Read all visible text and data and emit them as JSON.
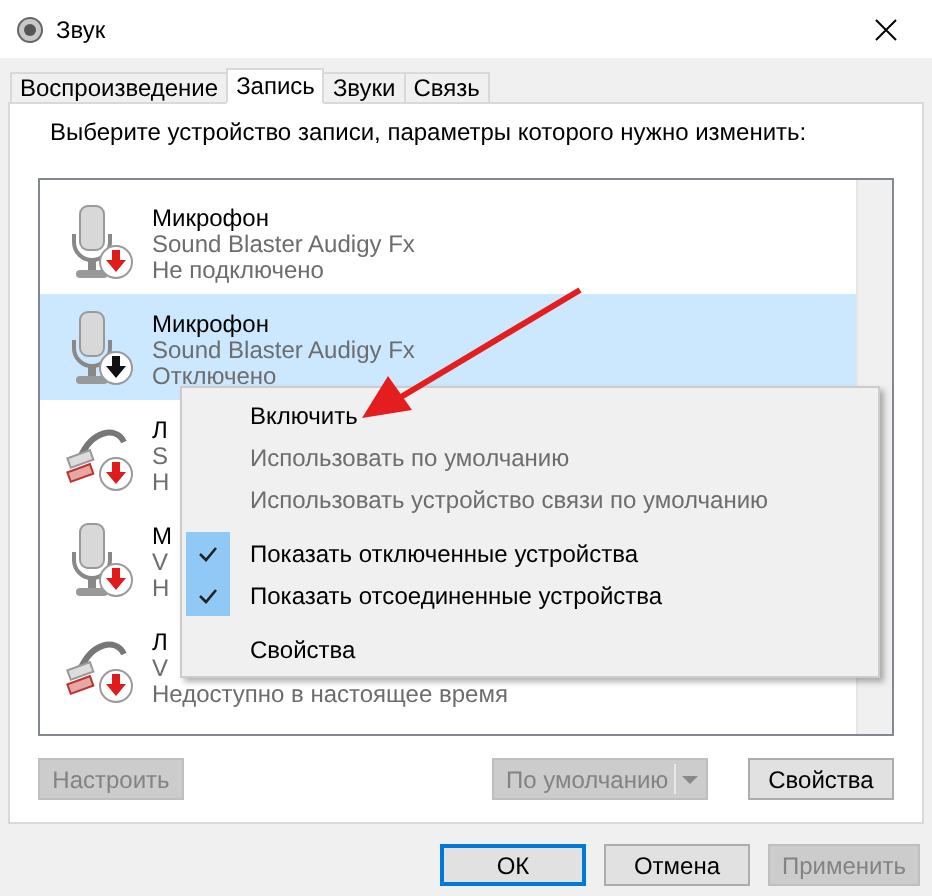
{
  "window": {
    "title": "Звук"
  },
  "tabs": [
    {
      "label": "Воспроизведение",
      "selected": false
    },
    {
      "label": "Запись",
      "selected": true
    },
    {
      "label": "Звуки",
      "selected": false
    },
    {
      "label": "Связь",
      "selected": false
    }
  ],
  "instruction": "Выберите устройство записи, параметры которого нужно изменить:",
  "devices": [
    {
      "kind": "microphone",
      "name": "Микрофон",
      "driver": "Sound Blaster Audigy Fx",
      "status": "Не подключено",
      "disabled": false,
      "selected": false
    },
    {
      "kind": "microphone",
      "name": "Микрофон",
      "driver": "Sound Blaster Audigy Fx",
      "status": "Отключено",
      "disabled": true,
      "selected": true
    },
    {
      "kind": "line",
      "name": "Л",
      "driver": "S",
      "status": "Н",
      "disabled": false,
      "selected": false
    },
    {
      "kind": "microphone",
      "name": "М",
      "driver": "V",
      "status": "Н",
      "disabled": false,
      "selected": false
    },
    {
      "kind": "line",
      "name": "Л",
      "driver": "V",
      "status": "Недоступно в настоящее время",
      "disabled": false,
      "selected": false
    }
  ],
  "context_menu": {
    "groups": [
      [
        {
          "label": "Включить",
          "disabled": false,
          "checked": false
        },
        {
          "label": "Использовать по умолчанию",
          "disabled": true,
          "checked": false
        },
        {
          "label": "Использовать устройство связи по умолчанию",
          "disabled": true,
          "checked": false
        }
      ],
      [
        {
          "label": "Показать отключенные устройства",
          "disabled": false,
          "checked": true
        },
        {
          "label": "Показать отсоединенные устройства",
          "disabled": false,
          "checked": true
        }
      ],
      [
        {
          "label": "Свойства",
          "disabled": false,
          "checked": false
        }
      ]
    ]
  },
  "panel_buttons": [
    {
      "kind": "button",
      "label": "Настроить",
      "disabled": true
    },
    {
      "kind": "split",
      "label": "По умолчанию",
      "disabled": true
    },
    {
      "kind": "button",
      "label": "Свойства",
      "disabled": false
    }
  ],
  "dialog_buttons": [
    {
      "label": "ОК",
      "disabled": false,
      "default": true
    },
    {
      "label": "Отмена",
      "disabled": false,
      "default": false
    },
    {
      "label": "Применить",
      "disabled": true,
      "default": false
    }
  ]
}
